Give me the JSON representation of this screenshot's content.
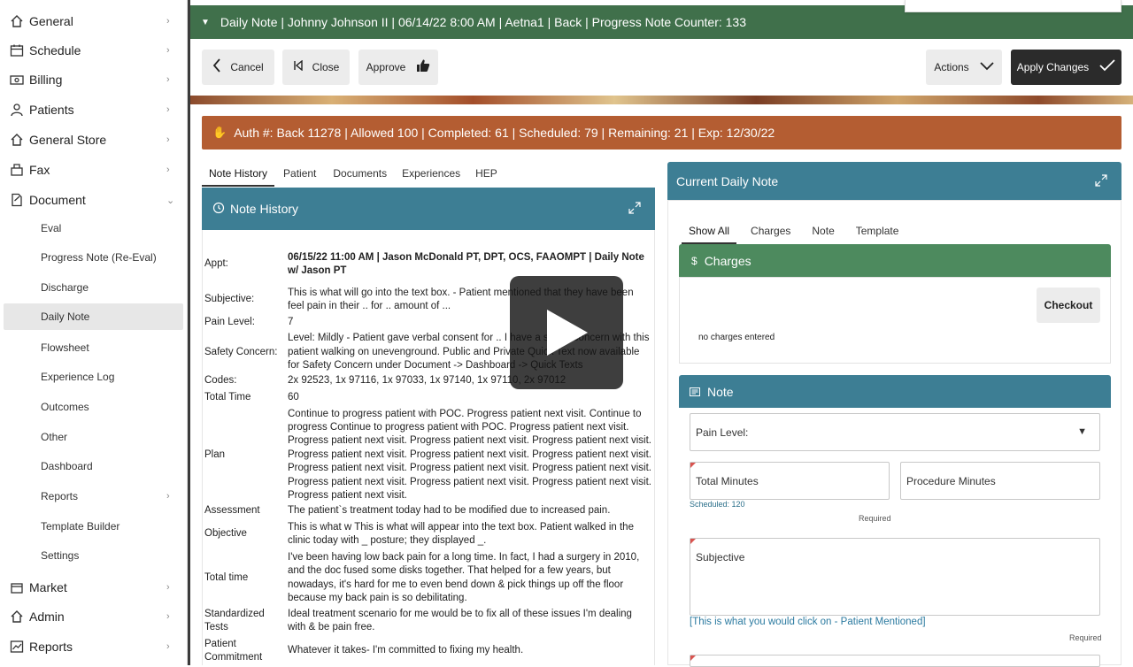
{
  "sidebar": {
    "items": [
      {
        "label": "General",
        "icon": "home-icon"
      },
      {
        "label": "Schedule",
        "icon": "calendar-icon"
      },
      {
        "label": "Billing",
        "icon": "money-icon"
      },
      {
        "label": "Patients",
        "icon": "user-icon"
      },
      {
        "label": "General Store",
        "icon": "store-icon"
      },
      {
        "label": "Fax",
        "icon": "fax-icon"
      },
      {
        "label": "Document",
        "icon": "document-icon"
      }
    ],
    "sub_items": [
      "Eval",
      "Progress Note (Re-Eval)",
      "Discharge",
      "Daily Note",
      "Flowsheet",
      "Experience Log",
      "Outcomes",
      "Other",
      "Dashboard",
      "Reports",
      "Template Builder",
      "Settings"
    ],
    "bottom_items": [
      {
        "label": "Market",
        "icon": "market-icon"
      },
      {
        "label": "Admin",
        "icon": "admin-icon"
      },
      {
        "label": "Reports",
        "icon": "chart-icon"
      }
    ]
  },
  "header": {
    "title": "Daily Note | Johnny Johnson II | 06/14/22 8:00 AM | Aetna1 | Back | Progress Note Counter: 133"
  },
  "toolbar": {
    "cancel": "Cancel",
    "close": "Close",
    "approve": "Approve",
    "actions": "Actions",
    "apply": "Apply Changes"
  },
  "auth": {
    "text": "Auth #: Back 11278 | Allowed 100 | Completed: 61 | Scheduled: 79 | Remaining: 21 | Exp: 12/30/22"
  },
  "left_tabs": [
    "Note History",
    "Patient",
    "Documents",
    "Experiences",
    "HEP"
  ],
  "note_history": {
    "title": "Note History",
    "rows": [
      {
        "key": "Appt:",
        "value": "06/15/22 11:00 AM | Jason McDonald PT, DPT, OCS, FAAOMPT | Daily Note w/ Jason PT"
      },
      {
        "key": "Subjective:",
        "value": "This is what will go into the text box. - Patient mentioned that they have been feel pain in their .. for .. amount of ..."
      },
      {
        "key": "Pain Level:",
        "value": "7"
      },
      {
        "key": "Safety Concern:",
        "value": "Level: Mildly - Patient gave verbal consent for .. I have a safety concern with this patient walking on unevenground. Public and Private Quick Text now available for Safety Concern under Document -> Dashboard -> Quick Texts"
      },
      {
        "key": "Codes:",
        "value": "2x 92523, 1x 97116, 1x 97033, 1x 97140, 1x 97110, 2x 97012"
      },
      {
        "key": "Total Time",
        "value": "60"
      },
      {
        "key": "Plan",
        "value": "Continue to progress patient with POC. Progress patient next visit. Continue to progress Continue to progress patient with POC. Progress patient next visit. Progress patient next visit. Progress patient next visit. Progress patient next visit. Progress patient next visit. Progress patient next visit. Progress patient next visit. Progress patient next visit. Progress patient next visit. Progress patient next visit. Progress patient next visit. Progress patient next visit. Progress patient next visit. Progress patient next visit."
      },
      {
        "key": "Assessment",
        "value": "The patient`s treatment today had to be modified due to increased pain."
      },
      {
        "key": "Objective",
        "value": " This is what w  This is what will appear into the text box. Patient walked in the clinic today with _ posture; they displayed _."
      },
      {
        "key": "Total time",
        "value": "I've been having low back pain for a long time. In fact, I had a surgery in 2010, and the doc fused some disks together. That helped for a few years, but nowadays, it's hard for me to even bend down & pick things up off the floor because my back pain is so debilitating."
      },
      {
        "key": "Standardized Tests",
        "value": "Ideal treatment scenario for me would be to fix all of these issues I'm dealing with & be pain free."
      },
      {
        "key": "Patient Commitment",
        "value": "Whatever it takes- I'm committed to fixing my health."
      }
    ]
  },
  "current_daily_note": {
    "title": "Current Daily Note",
    "tabs": [
      "Show All",
      "Charges",
      "Note",
      "Template"
    ],
    "charges": {
      "title": "Charges",
      "checkout": "Checkout",
      "empty": "no charges entered"
    },
    "note": {
      "title": "Note",
      "pain_level": "Pain Level:",
      "total_minutes": "Total Minutes",
      "procedure_minutes": "Procedure Minutes",
      "scheduled": "Scheduled: 120",
      "required": "Required",
      "subjective": "Subjective",
      "subjective_link": "[This is what you would click on - Patient Mentioned]",
      "required2": "Required"
    }
  },
  "colors": {
    "header_green": "#40704b",
    "auth_orange": "#b45d32",
    "panel_teal": "#3d7e94",
    "charges_green": "#4d8a5e"
  }
}
